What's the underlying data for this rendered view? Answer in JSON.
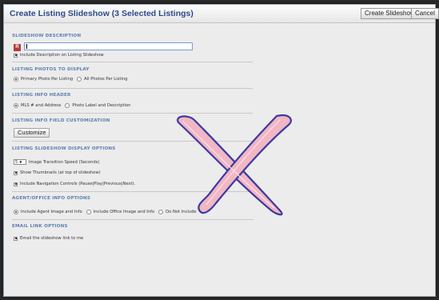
{
  "dialog": {
    "title": "Create Listing Slideshow (3 Selected Listings)",
    "create_label": "Create Slideshow",
    "separator": "|",
    "cancel_label": "Cancel"
  },
  "sections": {
    "description": {
      "header": "SLIDESHOW DESCRIPTION",
      "input_value": "",
      "editor_icon": "spellcheck-icon",
      "checkbox_label": "Include Description on Listing Slideshow",
      "checkbox_checked": true
    },
    "photos": {
      "header": "LISTING PHOTOS TO DISPLAY",
      "options": [
        "Primary Photo Per Listing",
        "All Photos Per Listing"
      ],
      "selected": 0
    },
    "info_header": {
      "header": "LISTING INFO HEADER",
      "options": [
        "MLS # and Address",
        "Photo Label and Description"
      ],
      "selected": 0
    },
    "field_customization": {
      "header": "LISTING INFO FIELD CUSTOMIZATION",
      "button_label": "Customize"
    },
    "display_options": {
      "header": "LISTING SLIDESHOW DISPLAY OPTIONS",
      "speed_value": "5",
      "speed_label": "Image Transition Speed (Seconds)",
      "thumbnails_label": "Show Thumbnails (at top of slideshow)",
      "thumbnails_checked": true,
      "nav_label": "Include Navigation Controls (Pause|Play|Previous|Next).",
      "nav_checked": true
    },
    "agent_office": {
      "header": "AGENT/OFFICE INFO OPTIONS",
      "options": [
        "Include Agent Image and Info",
        "Include Office Image and Info",
        "Do Not Include"
      ],
      "selected": 0
    },
    "email": {
      "header": "EMAIL LINK OPTIONS",
      "checkbox_label": "Email the slideshow link to me",
      "checkbox_checked": true
    }
  },
  "colors": {
    "title": "#2c4b8c",
    "section_header": "#5b7fb0",
    "annotation_fill": "#f2b6c4",
    "annotation_stroke": "#3a3aa0"
  }
}
